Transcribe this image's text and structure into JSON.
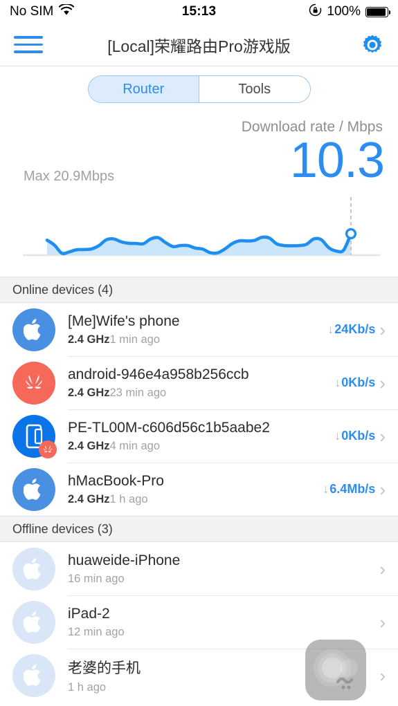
{
  "status_bar": {
    "carrier": "No SIM",
    "wifi_icon": "wifi-icon",
    "time": "15:13",
    "rotation_lock_icon": "rotation-lock-icon",
    "battery_percent": "100%",
    "battery_icon": "battery-full-icon"
  },
  "nav": {
    "menu_icon": "hamburger-menu-icon",
    "title": "[Local]荣耀路由Pro游戏版",
    "settings_icon": "gear-icon"
  },
  "tabs": {
    "items": [
      {
        "label": "Router",
        "active": true
      },
      {
        "label": "Tools",
        "active": false
      }
    ]
  },
  "speed_panel": {
    "rate_label": "Download rate / Mbps",
    "rate_value": "10.3",
    "max_label": "Max 20.9Mbps",
    "accent_color": "#2d8cf0",
    "fill_color": "#cbe5fb"
  },
  "chart_data": {
    "type": "area",
    "title": "Download rate / Mbps",
    "ylabel": "Mbps",
    "xlabel": "",
    "grid": false,
    "legend": null,
    "ylim": [
      0,
      20.9
    ],
    "annotations": [
      {
        "text": "Max 20.9Mbps",
        "position": "top-left"
      },
      {
        "text": "10.3",
        "position": "current-value"
      }
    ],
    "current_marker": {
      "x": 33,
      "y": 10.3
    },
    "x": [
      0,
      1,
      2,
      3,
      4,
      5,
      6,
      7,
      8,
      9,
      10,
      11,
      12,
      13,
      14,
      15,
      16,
      17,
      18,
      19,
      20,
      21,
      22,
      23,
      24,
      25,
      26,
      27,
      28,
      29,
      30,
      31,
      32,
      33
    ],
    "values": [
      7.2,
      4.8,
      0.9,
      1.6,
      2.6,
      2.7,
      3.0,
      4.6,
      7.4,
      7.8,
      6.4,
      5.7,
      5.6,
      5.5,
      7.8,
      8.4,
      6.0,
      4.1,
      4.6,
      4.6,
      3.4,
      2.9,
      1.2,
      1.1,
      3.0,
      5.6,
      6.9,
      6.8,
      7.1,
      8.6,
      8.2,
      5.4,
      4.6,
      4.5,
      4.6,
      5.2,
      7.8,
      7.4,
      3.6,
      2.0,
      2.4,
      10.3
    ]
  },
  "sections": [
    {
      "header": "Online devices (4)",
      "devices": [
        {
          "name": "[Me]Wife's phone",
          "band": "2.4 GHz",
          "last_seen": "1 min ago",
          "speed": "24Kb/s",
          "arrow": "↓",
          "icon": "apple-icon",
          "icon_style": "apple",
          "chevron": "›"
        },
        {
          "name": "android-946e4a958b256ccb",
          "band": "2.4 GHz",
          "last_seen": "23 min ago",
          "speed": "0Kb/s",
          "arrow": "↓",
          "icon": "huawei-icon",
          "icon_style": "huawei",
          "chevron": "›"
        },
        {
          "name": "PE-TL00M-c606d56c1b5aabe2",
          "band": "2.4 GHz",
          "last_seen": "4 min ago",
          "speed": "0Kb/s",
          "arrow": "↓",
          "icon": "phone-icon",
          "icon_style": "phone-huawei",
          "chevron": "›"
        },
        {
          "name": "hMacBook-Pro",
          "band": "2.4 GHz",
          "last_seen": "1 h ago",
          "speed": "6.4Mb/s",
          "arrow": "↓",
          "icon": "apple-icon",
          "icon_style": "apple",
          "chevron": "›"
        }
      ]
    },
    {
      "header": "Offline devices (3)",
      "devices": [
        {
          "name": "huaweide-iPhone",
          "band": "",
          "last_seen": "16 min ago",
          "speed": "",
          "arrow": "",
          "icon": "apple-icon",
          "icon_style": "offline",
          "chevron": "›"
        },
        {
          "name": "iPad-2",
          "band": "",
          "last_seen": "12 min ago",
          "speed": "",
          "arrow": "",
          "icon": "apple-icon",
          "icon_style": "offline",
          "chevron": "›"
        },
        {
          "name": "老婆的手机",
          "band": "",
          "last_seen": "1 h ago",
          "speed": "",
          "arrow": "",
          "icon": "apple-icon",
          "icon_style": "offline",
          "chevron": "›"
        }
      ]
    }
  ],
  "overlay": {
    "assistive_touch_icon": "assistive-touch-icon"
  }
}
